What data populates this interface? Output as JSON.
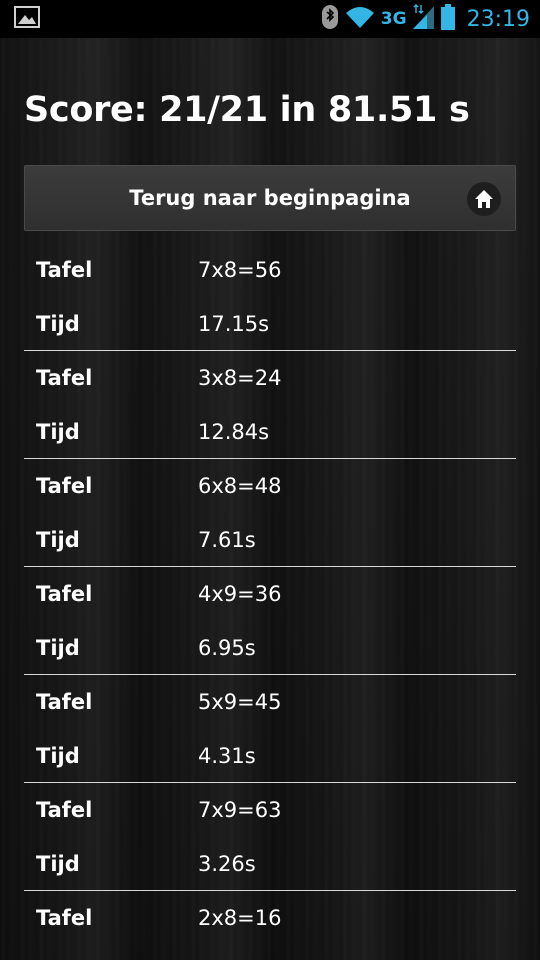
{
  "status_bar": {
    "network_type": "3G",
    "time": "23:19",
    "icons": [
      "image-notification-icon",
      "bluetooth-icon",
      "wifi-icon",
      "signal-icon",
      "battery-icon"
    ]
  },
  "score": {
    "text": "Score: 21/21 in 81.51 s"
  },
  "home_bar": {
    "label": "Terug naar beginpagina",
    "icon": "home-icon"
  },
  "results": [
    {
      "tafel_label": "Tafel",
      "tafel": "7x8=56",
      "tijd_label": "Tijd",
      "tijd": "17.15s"
    },
    {
      "tafel_label": "Tafel",
      "tafel": "3x8=24",
      "tijd_label": "Tijd",
      "tijd": "12.84s"
    },
    {
      "tafel_label": "Tafel",
      "tafel": "6x8=48",
      "tijd_label": "Tijd",
      "tijd": "7.61s"
    },
    {
      "tafel_label": "Tafel",
      "tafel": "4x9=36",
      "tijd_label": "Tijd",
      "tijd": "6.95s"
    },
    {
      "tafel_label": "Tafel",
      "tafel": "5x9=45",
      "tijd_label": "Tijd",
      "tijd": "4.31s"
    },
    {
      "tafel_label": "Tafel",
      "tafel": "7x9=63",
      "tijd_label": "Tijd",
      "tijd": "3.26s"
    },
    {
      "tafel_label": "Tafel",
      "tafel": "2x8=16"
    }
  ],
  "colors": {
    "accent": "#33b5e5",
    "text": "#ffffff",
    "divider": "#d8d8d8"
  }
}
